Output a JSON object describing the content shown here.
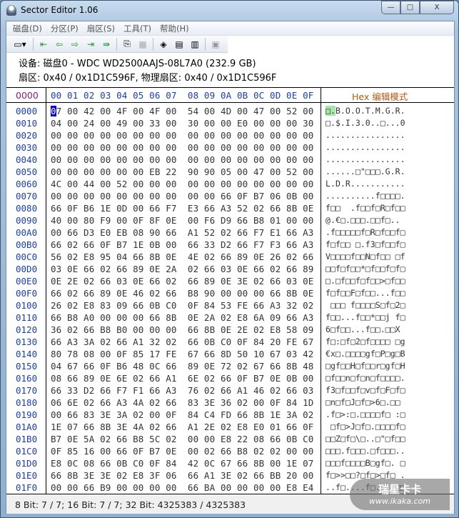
{
  "window": {
    "title": "Sector Editor 1.06",
    "controls": [
      "—",
      "□",
      "X"
    ]
  },
  "menu": [
    "磁盘(D)",
    "分区(P)",
    "扇区(S)",
    "工具(T)",
    "帮助(H)"
  ],
  "toolbar": [
    "disk-dropdown",
    "first-sector",
    "prev-sector",
    "next-sector",
    "last-sector",
    "goto-sector",
    "copy",
    "paste",
    "fill",
    "export",
    "import",
    "save"
  ],
  "info": {
    "device": "设备: 磁盘0 - WDC WD2500AAJS-08L7A0 (232.9 GB)",
    "sector": "扇区: 0x40 / 0x1D1C596F, 物理扇区: 0x40 / 0x1D1C596F"
  },
  "header": {
    "addr": "0000",
    "cols": "00 01 02 03 04 05 06 07  08 09 0A 0B 0C 0D 0E 0F",
    "mode": "Hex 编辑模式"
  },
  "rows": [
    {
      "addr": "0000",
      "hex": "07 00 42 00 4F 00 4F 00  54 00 4D 00 47 00 52 00",
      "ascii": "□.B.O.O.T.M.G.R."
    },
    {
      "addr": "0010",
      "hex": "04 00 24 00 49 00 33 00  30 00 00 E0 00 00 00 30",
      "ascii": "□.$.I.3.0..□...0"
    },
    {
      "addr": "0020",
      "hex": "00 00 00 00 00 00 00 00  00 00 00 00 00 00 00 00",
      "ascii": "................"
    },
    {
      "addr": "0030",
      "hex": "00 00 00 00 00 00 00 00  00 00 00 00 00 00 00 00",
      "ascii": "................"
    },
    {
      "addr": "0040",
      "hex": "00 00 00 00 00 00 00 00  00 00 00 00 00 00 00 00",
      "ascii": "................"
    },
    {
      "addr": "0050",
      "hex": "00 00 00 00 00 00 EB 22  90 90 05 00 47 00 52 00",
      "ascii": "......□\"□□□.G.R."
    },
    {
      "addr": "0060",
      "hex": "4C 00 44 00 52 00 00 00  00 00 00 00 00 00 00 00",
      "ascii": "L.D.R..........."
    },
    {
      "addr": "0070",
      "hex": "00 00 00 00 00 00 00 00  00 00 66 0F B7 06 0B 00",
      "ascii": "..........f□□□□."
    },
    {
      "addr": "0080",
      "hex": "66 0F B6 1E 0D 00 66 F7  E3 66 A3 52 02 66 8B 0E",
      "ascii": "f□□  .f□□f□R□f□□"
    },
    {
      "addr": "0090",
      "hex": "40 00 80 F9 00 0F 8F 0E  00 F6 D9 66 B8 01 00 00",
      "ascii": "@.€□.□□□.□□f□.."
    },
    {
      "addr": "00A0",
      "hex": "00 66 D3 E0 EB 08 90 66  A1 52 02 66 F7 E1 66 A3",
      "ascii": ".f□□□□□f□R□f□□f□"
    },
    {
      "addr": "00B0",
      "hex": "66 02 66 0F B7 1E 0B 00  66 33 D2 66 F7 F3 66 A3",
      "ascii": "f□f□□ □.f3□f□□f□"
    },
    {
      "addr": "00C0",
      "hex": "56 02 E8 95 04 66 8B 0E  4E 02 66 89 0E 26 02 66",
      "ascii": "V□□□□f□□N□f□□ □f"
    },
    {
      "addr": "00D0",
      "hex": "03 0E 66 02 66 89 0E 2A  02 66 03 0E 66 02 66 89",
      "ascii": "□□f□f□□*□f□□f□f□"
    },
    {
      "addr": "00E0",
      "hex": "0E 2E 02 66 03 0E 66 02  66 89 0E 3E 02 66 03 0E",
      "ascii": "□.□f□□f□f□□>□f□□"
    },
    {
      "addr": "00F0",
      "hex": "66 02 66 89 0E 46 02 66  B8 90 00 00 00 66 8B 0E",
      "ascii": "f□f□□F□f□□...f□□"
    },
    {
      "addr": "0100",
      "hex": "26 02 E8 83 09 66 0B C0  0F 84 53 FE 66 A3 32 02",
      "ascii": " □□□ f□□□□S□f□2□"
    },
    {
      "addr": "0110",
      "hex": "66 B8 A0 00 00 00 66 8B  0E 2A 02 E8 6A 09 66 A3",
      "ascii": "f□□...f□□*□□j f□"
    },
    {
      "addr": "0120",
      "hex": "36 02 66 B8 B0 00 00 00  66 8B 0E 2E 02 E8 58 09",
      "ascii": "6□f□□...f□□.□□X"
    },
    {
      "addr": "0130",
      "hex": "66 A3 3A 02 66 A1 32 02  66 0B C0 0F 84 20 FE 67",
      "ascii": "f□:□f□2□f□□□□ □g"
    },
    {
      "addr": "0140",
      "hex": "80 78 08 00 0F 85 17 FE  67 66 8D 50 10 67 03 42",
      "ascii": "€x□.□□□□gf□P□g□B"
    },
    {
      "addr": "0150",
      "hex": "04 67 66 0F B6 48 0C 66  89 0E 72 02 67 66 8B 48",
      "ascii": "□gf□□H□f□□r□gf□H"
    },
    {
      "addr": "0160",
      "hex": "08 66 89 0E 6E 02 66 A1  6E 02 66 0F B7 0E 0B 00",
      "ascii": "□f□□n□f□n□f□□□□."
    },
    {
      "addr": "0170",
      "hex": "66 33 D2 66 F7 F1 66 A3  76 02 66 A1 46 02 66 03",
      "ascii": "f3□f□□f□v□f□F□f□"
    },
    {
      "addr": "0180",
      "hex": "06 6E 02 66 A3 4A 02 66  83 3E 36 02 00 0F 84 1D",
      "ascii": "□n□f□J□f□>6□.□□"
    },
    {
      "addr": "0190",
      "hex": "00 66 83 3E 3A 02 00 0F  84 C4 FD 66 8B 1E 3A 02",
      "ascii": ".f□>:□.□□□□f□ :□"
    },
    {
      "addr": "01A0",
      "hex": "1E 07 66 8B 3E 4A 02 66  A1 2E 02 E8 E0 01 66 0F",
      "ascii": " □f□>J□f□.□□□□f□"
    },
    {
      "addr": "01B0",
      "hex": "B7 0E 5A 02 66 B8 5C 02  00 00 E8 22 08 66 0B C0",
      "ascii": "□□Z□f□\\□..□\"□f□□"
    },
    {
      "addr": "01C0",
      "hex": "0F 85 16 00 66 0F B7 0E  00 02 66 B8 02 02 00 00",
      "ascii": "□□□.f□□□.□f□□□.."
    },
    {
      "addr": "01D0",
      "hex": "E8 0C 08 66 0B C0 0F 84  42 0C 67 66 8B 00 1E 07",
      "ascii": "□□□f□□□□B□gf□. □"
    },
    {
      "addr": "01E0",
      "hex": "66 8B 3E 3E 02 E8 3F 06  66 A1 3E 02 66 BB 20 00",
      "ascii": "f□>>□□?□f□>□f□ ."
    },
    {
      "addr": "01F0",
      "hex": "00 00 66 B9 00 00 00 00  66 BA 00 00 00 00 E8 E4",
      "ascii": "..f□....f□....□□"
    }
  ],
  "status": "8 Bit: 7 / 7;  16 Bit: 7 / 7;  32 Bit: 4325383 / 4325383",
  "watermark": {
    "name": "瑞星卡卡",
    "url": "www.ikaka.com"
  }
}
